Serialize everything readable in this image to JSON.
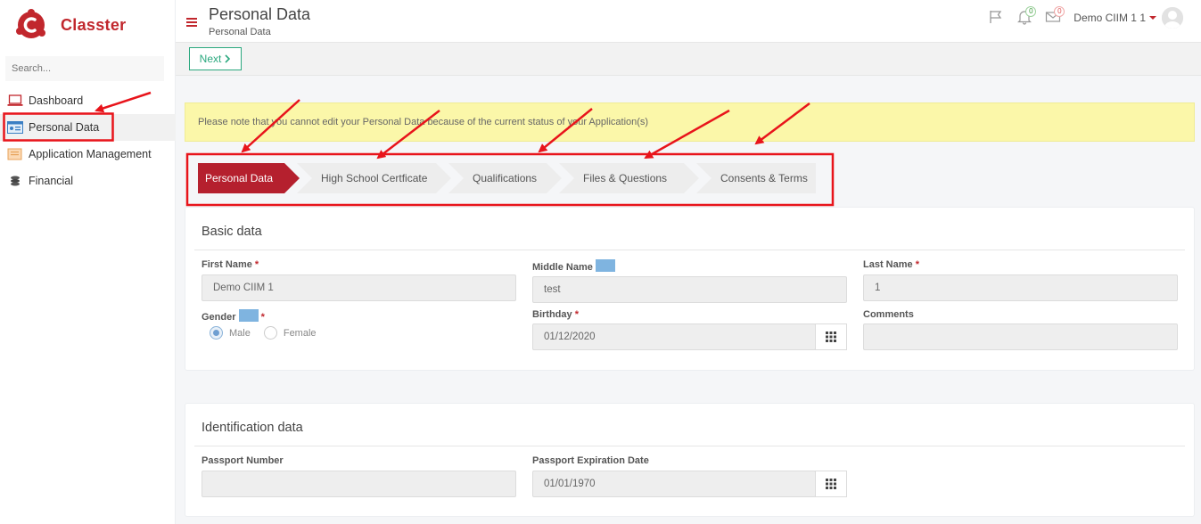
{
  "app": {
    "name": "Classter"
  },
  "sidebar": {
    "search_placeholder": "Search...",
    "items": [
      {
        "label": "Dashboard",
        "icon": "laptop-icon"
      },
      {
        "label": "Personal Data",
        "icon": "id-card-icon"
      },
      {
        "label": "Application Management",
        "icon": "folder-icon"
      },
      {
        "label": "Financial",
        "icon": "coins-icon"
      }
    ]
  },
  "header": {
    "title": "Personal Data",
    "subtitle": "Personal Data",
    "notifications_count": "0",
    "messages_count": "0",
    "user_name": "Demo CIIM 1 1"
  },
  "toolbar": {
    "next_label": "Next"
  },
  "alert": {
    "text": "Please note that you cannot edit your Personal Data because of the current status of your Application(s)"
  },
  "steps": [
    {
      "label": "Personal Data"
    },
    {
      "label": "High School Certficate"
    },
    {
      "label": "Qualifications"
    },
    {
      "label": "Files & Questions"
    },
    {
      "label": "Consents & Terms"
    }
  ],
  "basic": {
    "title": "Basic data",
    "first_name_label": "First Name",
    "first_name_value": "Demo CIIM 1",
    "middle_name_label": "Middle Name",
    "middle_name_value": "test",
    "last_name_label": "Last Name",
    "last_name_value": "1",
    "gender_label": "Gender",
    "gender_options": [
      "Male",
      "Female"
    ],
    "birthday_label": "Birthday",
    "birthday_value": "01/12/2020",
    "comments_label": "Comments",
    "required_mark": "*"
  },
  "identification": {
    "title": "Identification data",
    "passport_number_label": "Passport Number",
    "passport_expiration_label": "Passport Expiration Date",
    "passport_expiration_value": "01/01/1970"
  },
  "colors": {
    "brand": "#c1272d",
    "active_step": "#b5202e",
    "next_button": "#2aa87e",
    "alert_bg": "#fbf7a9",
    "annotation": "#e8141b"
  }
}
